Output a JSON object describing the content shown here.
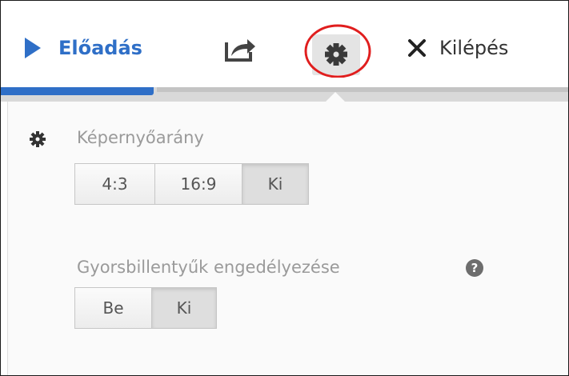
{
  "toolbar": {
    "present_label": "Előadás",
    "exit_label": "Kilépés",
    "accent_color": "#2f6fc7",
    "highlight_color": "#e01e1e",
    "icons": {
      "present": "play-icon",
      "share": "share-icon",
      "settings": "gear-icon",
      "exit": "close-icon"
    }
  },
  "progress": {
    "value_percent": 27
  },
  "settings": {
    "aspect": {
      "title": "Képernyőarány",
      "icon": "gear-icon",
      "options": [
        {
          "label": "4:3",
          "selected": false
        },
        {
          "label": "16:9",
          "selected": false
        },
        {
          "label": "Ki",
          "selected": true
        }
      ]
    },
    "shortcuts": {
      "title": "Gyorsbillentyűk engedélyezése",
      "help_label": "?",
      "options": [
        {
          "label": "Be",
          "selected": false
        },
        {
          "label": "Ki",
          "selected": true
        }
      ]
    }
  }
}
